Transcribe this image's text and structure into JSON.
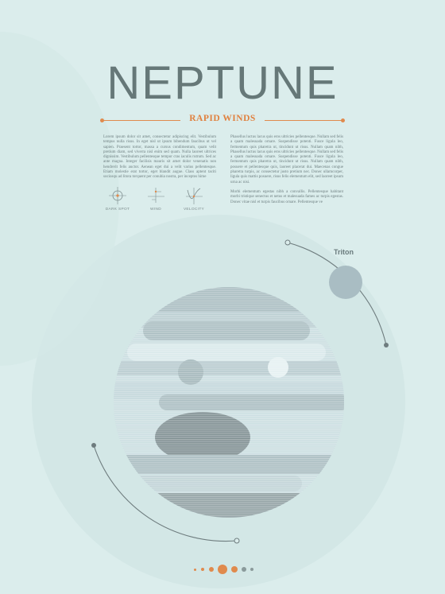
{
  "poster": {
    "title": "NEPTUNE",
    "subtitle": "RAPID WINDS",
    "moon_label": "Triton",
    "column_left": [
      "Lorem ipsum dolor sit amet, consectetur adipiscing elit. Vestibulum tempus nulla risus. In eget nisl ut ipsum bibendum faucibus ut vel sapien. Praesent tortor, massa a cursus condimentum, quam velit pretium diam, sed viverra nisl enim sed quam. Nulla laoreet ultrices dignissim. Vestibulum pellentesque tempor cras iaculis rutrum. Sed ac ante magna. Integer facilisis mauris sit amet dolor venenatis non hendrerit felis auctor. Aenean eget dui a velit varius pellentesque. Etiam molestie erat tortor, eget blandit augue. Class aptent taciti sociosqu ad litora torquent per conubia nostra, per inceptos hime"
    ],
    "column_right": [
      "Phasellus luctus lacus quis eros ultricies pellentesque. Nullam sed felis a quam malesuada ornare. Suspendisse potenti. Fusce ligula leo, fermentum quis pharetra ut, tincidunt ut risus. Nullam quam nibh, Phasellus luctus lacus quis eros ultricies pellentesque. Nullam sed felis a quam malesuada ornare. Suspendisse potenti. Fusce ligula leo, fermentum quis pharetra ut, tincidunt ut risus. Nullam quam nibh, posuere et pellentesque quis, laoreet placerat dui. Maecenas congue pharetra turpis, ac consectetur justo pretium nec. Donec ullamcorper, ligula quis mattis posuere, risus felis elementum elit, sed laoreet ipsum urna ac nisi.",
      "Morbi elementum egestas nibh a convallis. Pellentesque habitant morbi tristique senectus et netus et malesuada fames ac turpis egestas. Donec vitae nisl et turpis faucibus ornare. Pellentesque ve"
    ],
    "icons": [
      {
        "icon": "crosshair-icon",
        "label": "DARK SPOT"
      },
      {
        "icon": "axis-graph-icon",
        "label": "WIND"
      },
      {
        "icon": "velocity-curve-icon",
        "label": "VELOCITY"
      }
    ],
    "pager": {
      "count": 7,
      "active_index": 3
    }
  },
  "colors": {
    "background": "#dbedec",
    "title": "#667878",
    "accent": "#e0813f",
    "planet_light": "#c9dde0",
    "planet_mid": "#a8bcc0",
    "planet_dark": "#7d8d90",
    "orbit": "#6e7c7e",
    "moon": "#a9bdc3"
  }
}
